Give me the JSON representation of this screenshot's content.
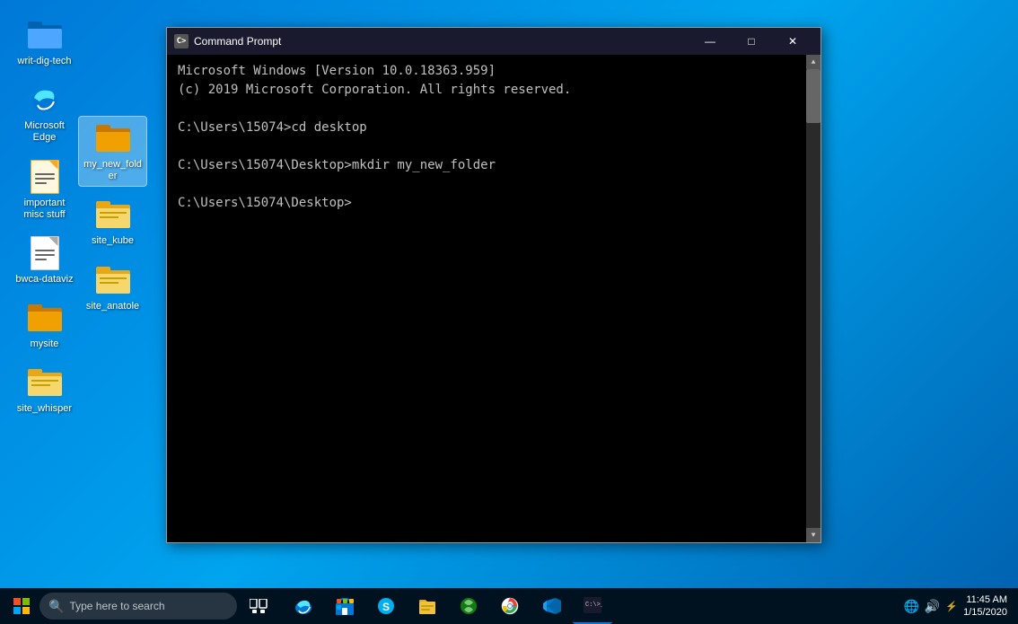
{
  "desktop": {
    "background_color": "#0078d7"
  },
  "icons": {
    "col1": [
      {
        "id": "writ-dig-tech",
        "label": "writ-dig-tech",
        "type": "folder-blue"
      },
      {
        "id": "microsoft-edge",
        "label": "Microsoft Edge",
        "type": "edge"
      },
      {
        "id": "important-misc-stuff",
        "label": "important misc stuff",
        "type": "doc"
      },
      {
        "id": "bwca-dataviz",
        "label": "bwca-dataviz",
        "type": "doc"
      },
      {
        "id": "mysite",
        "label": "mysite",
        "type": "folder-orange"
      },
      {
        "id": "site-whisper",
        "label": "site_whisper",
        "type": "folder-with-lines"
      }
    ],
    "col2": [
      {
        "id": "my-new-folder",
        "label": "my_new_folder",
        "type": "folder-orange",
        "selected": true
      },
      {
        "id": "site-kube",
        "label": "site_kube",
        "type": "folder-with-lines"
      },
      {
        "id": "site-anatole",
        "label": "site_anatole",
        "type": "folder-with-lines"
      }
    ]
  },
  "cmd_window": {
    "title": "Command Prompt",
    "title_icon": "C>",
    "content_lines": [
      "Microsoft Windows [Version 10.0.18363.959]",
      "(c) 2019 Microsoft Corporation. All rights reserved.",
      "",
      "C:\\Users\\15074>cd desktop",
      "",
      "C:\\Users\\15074\\Desktop>mkdir my_new_folder",
      "",
      "C:\\Users\\15074\\Desktop>"
    ],
    "controls": {
      "minimize": "—",
      "maximize": "□",
      "close": "✕"
    }
  },
  "taskbar": {
    "search_placeholder": "Type here to search",
    "icons": [
      {
        "id": "edge",
        "symbol": "🌐",
        "label": "Microsoft Edge"
      },
      {
        "id": "store",
        "symbol": "🛍",
        "label": "Microsoft Store"
      },
      {
        "id": "skype",
        "symbol": "💬",
        "label": "Skype"
      },
      {
        "id": "file-explorer",
        "symbol": "📁",
        "label": "File Explorer"
      },
      {
        "id": "xbox",
        "symbol": "🎮",
        "label": "Xbox"
      },
      {
        "id": "chrome",
        "symbol": "🌍",
        "label": "Google Chrome"
      },
      {
        "id": "vscode",
        "symbol": "💻",
        "label": "Visual Studio Code"
      },
      {
        "id": "cmd",
        "symbol": "▮",
        "label": "Command Prompt",
        "active": true
      }
    ]
  }
}
